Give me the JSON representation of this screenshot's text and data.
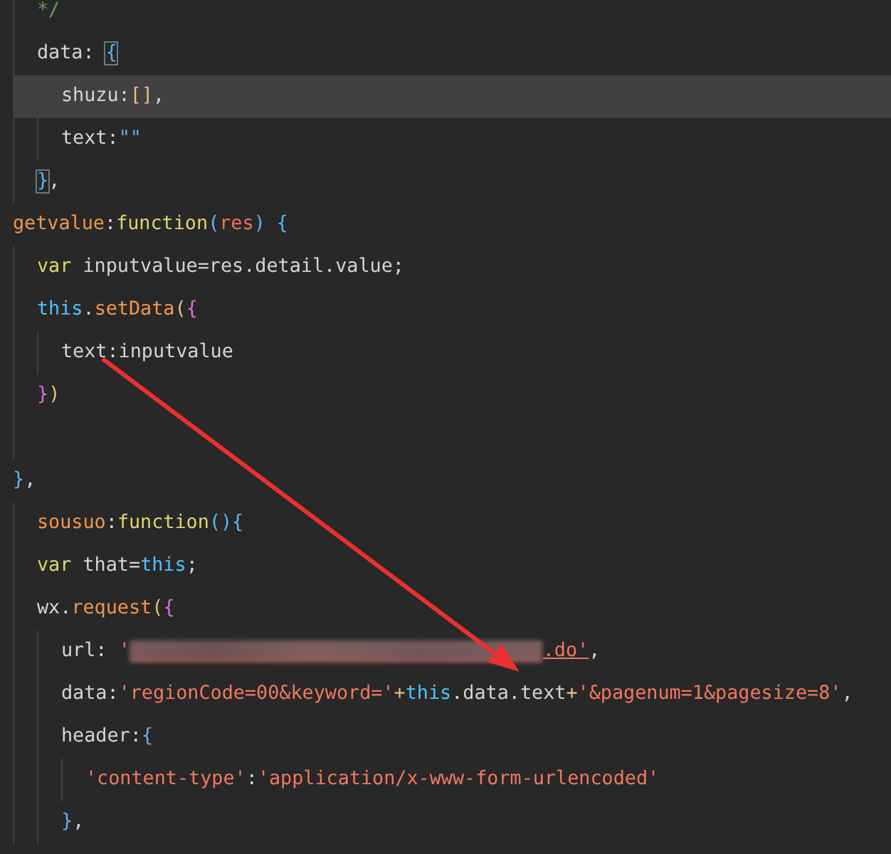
{
  "code": [
    {
      "kind": "group",
      "children": [
        {
          "kind": "line",
          "current_line": false,
          "tokens": [
            {
              "kind": "comment",
              "text": "*/"
            }
          ]
        },
        {
          "kind": "line",
          "current_line": false,
          "tokens": [
            {
              "kind": "plain",
              "text": "data: "
            },
            {
              "kind": "brace",
              "text": "{",
              "boxed": true
            }
          ],
          "children": [
            {
              "kind": "line",
              "current_line": true,
              "tokens": [
                {
                  "kind": "plain",
                  "text": "shuzu:"
                },
                {
                  "kind": "bracket",
                  "text": "[]"
                },
                {
                  "kind": "plain",
                  "text": ","
                }
              ]
            },
            {
              "kind": "line",
              "current_line": false,
              "tokens": [
                {
                  "kind": "plain",
                  "text": "text:"
                },
                {
                  "kind": "brace",
                  "text": "\"\""
                }
              ]
            }
          ]
        },
        {
          "kind": "line",
          "current_line": false,
          "tokens": [
            {
              "kind": "brace",
              "text": "}",
              "boxed": true
            },
            {
              "kind": "plain",
              "text": ","
            }
          ]
        }
      ]
    },
    {
      "kind": "line",
      "current_line": false,
      "tokens": [
        {
          "kind": "func",
          "text": "getvalue"
        },
        {
          "kind": "plain",
          "text": ":"
        },
        {
          "kind": "keyword",
          "text": "function"
        },
        {
          "kind": "brace",
          "text": "("
        },
        {
          "kind": "param",
          "text": "res"
        },
        {
          "kind": "brace",
          "text": ") {"
        }
      ],
      "children": [
        {
          "kind": "line",
          "current_line": false,
          "tokens": [
            {
              "kind": "keyword",
              "text": "var"
            },
            {
              "kind": "plain",
              "text": " inputvalue=res.detail.value;"
            }
          ]
        },
        {
          "kind": "line",
          "current_line": false,
          "tokens": [
            {
              "kind": "this",
              "text": "this"
            },
            {
              "kind": "plain",
              "text": "."
            },
            {
              "kind": "func",
              "text": "setData"
            },
            {
              "kind": "bracket",
              "text": "("
            },
            {
              "kind": "magenta",
              "text": "{"
            }
          ],
          "children": [
            {
              "kind": "line",
              "current_line": false,
              "tokens": [
                {
                  "kind": "plain",
                  "text": "text:inputvalue"
                }
              ]
            }
          ]
        },
        {
          "kind": "line",
          "current_line": false,
          "tokens": [
            {
              "kind": "magenta",
              "text": "}"
            },
            {
              "kind": "bracket",
              "text": ")"
            }
          ]
        },
        {
          "kind": "blank"
        }
      ]
    },
    {
      "kind": "line",
      "current_line": false,
      "tokens": [
        {
          "kind": "brace",
          "text": "}"
        },
        {
          "kind": "plain",
          "text": ","
        }
      ]
    },
    {
      "kind": "group",
      "children": [
        {
          "kind": "line",
          "current_line": false,
          "tokens": [
            {
              "kind": "func",
              "text": "sousuo"
            },
            {
              "kind": "plain",
              "text": ":"
            },
            {
              "kind": "keyword",
              "text": "function"
            },
            {
              "kind": "brace",
              "text": "(){"
            }
          ]
        },
        {
          "kind": "line",
          "current_line": false,
          "tokens": [
            {
              "kind": "keyword",
              "text": "var"
            },
            {
              "kind": "plain",
              "text": " that="
            },
            {
              "kind": "this",
              "text": "this"
            },
            {
              "kind": "plain",
              "text": ";"
            }
          ]
        },
        {
          "kind": "line",
          "current_line": false,
          "tokens": [
            {
              "kind": "plain",
              "text": "wx."
            },
            {
              "kind": "func",
              "text": "request"
            },
            {
              "kind": "bracket",
              "text": "("
            },
            {
              "kind": "magenta",
              "text": "{"
            }
          ],
          "children": [
            {
              "kind": "line",
              "current_line": false,
              "tokens": [
                {
                  "kind": "plain",
                  "text": "url: "
                },
                {
                  "kind": "string",
                  "text": "'"
                },
                {
                  "kind": "redacted"
                },
                {
                  "kind": "link",
                  "text": ".do'"
                },
                {
                  "kind": "plain",
                  "text": ","
                }
              ]
            },
            {
              "kind": "line",
              "current_line": false,
              "tokens": [
                {
                  "kind": "plain",
                  "text": "data:"
                },
                {
                  "kind": "string",
                  "text": "'regionCode=00&keyword='"
                },
                {
                  "kind": "bracket",
                  "text": "+"
                },
                {
                  "kind": "this",
                  "text": "this"
                },
                {
                  "kind": "plain",
                  "text": ".data.text"
                },
                {
                  "kind": "bracket",
                  "text": "+"
                },
                {
                  "kind": "string",
                  "text": "'&pagenum=1&pagesize=8'"
                },
                {
                  "kind": "plain",
                  "text": ","
                }
              ]
            },
            {
              "kind": "line",
              "current_line": false,
              "tokens": [
                {
                  "kind": "plain",
                  "text": "header:"
                },
                {
                  "kind": "brace",
                  "text": "{"
                }
              ],
              "children": [
                {
                  "kind": "line",
                  "current_line": false,
                  "tokens": [
                    {
                      "kind": "string",
                      "text": "'content-type'"
                    },
                    {
                      "kind": "plain",
                      "text": ":"
                    },
                    {
                      "kind": "string",
                      "text": "'application/x-www-form-urlencoded'"
                    }
                  ]
                }
              ]
            },
            {
              "kind": "line",
              "current_line": false,
              "tokens": [
                {
                  "kind": "brace",
                  "text": "}"
                },
                {
                  "kind": "plain",
                  "text": ","
                }
              ]
            }
          ]
        }
      ]
    }
  ]
}
